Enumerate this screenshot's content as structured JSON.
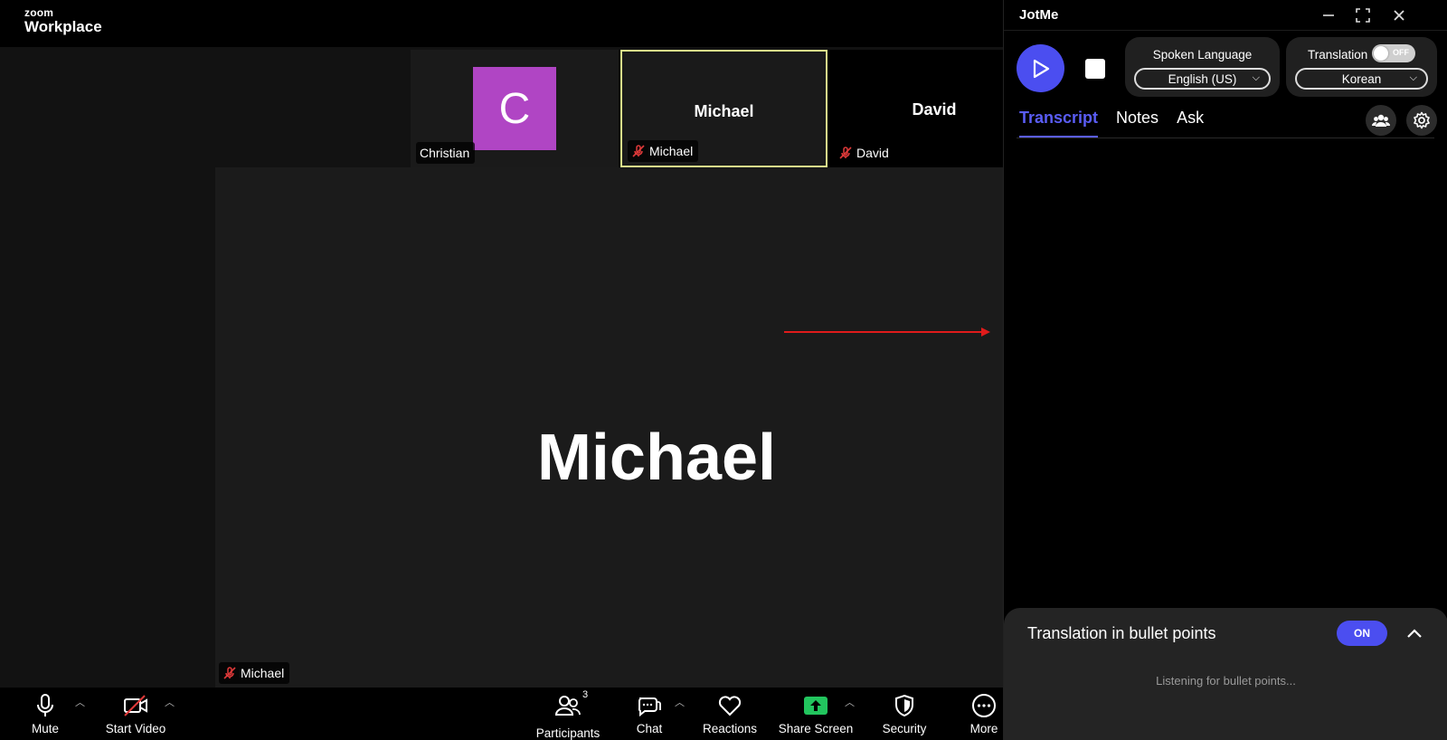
{
  "zoom": {
    "logo_small": "zoom",
    "logo_big": "Workplace",
    "tiles": [
      {
        "center": "",
        "avatar_letter": "C",
        "tag": "Christian",
        "muted": false
      },
      {
        "center": "Michael",
        "avatar_letter": "",
        "tag": "Michael",
        "muted": true,
        "active": true
      },
      {
        "center": "David",
        "avatar_letter": "",
        "tag": "David",
        "muted": true
      }
    ],
    "main_speaker": "Michael",
    "main_tag": "Michael",
    "toolbar": {
      "mute": "Mute",
      "start_video": "Start Video",
      "participants": "Participants",
      "participants_count": "3",
      "chat": "Chat",
      "reactions": "Reactions",
      "share_screen": "Share Screen",
      "security": "Security",
      "more": "More"
    },
    "colors": {
      "active_border": "#d8e48a",
      "avatar": "#b045c4",
      "share": "#22c55e",
      "arrow": "#e01b1b"
    }
  },
  "jotme": {
    "title": "JotMe",
    "spoken_language_label": "Spoken Language",
    "spoken_language_value": "English (US)",
    "translation_label": "Translation",
    "translation_toggle": "OFF",
    "translation_language": "Korean",
    "tabs": [
      "Transcript",
      "Notes",
      "Ask"
    ],
    "active_tab": "Transcript",
    "bullets_title": "Translation in bullet points",
    "bullets_toggle": "ON",
    "listening_text": "Listening for bullet points...",
    "accent": "#4b4ef0"
  }
}
